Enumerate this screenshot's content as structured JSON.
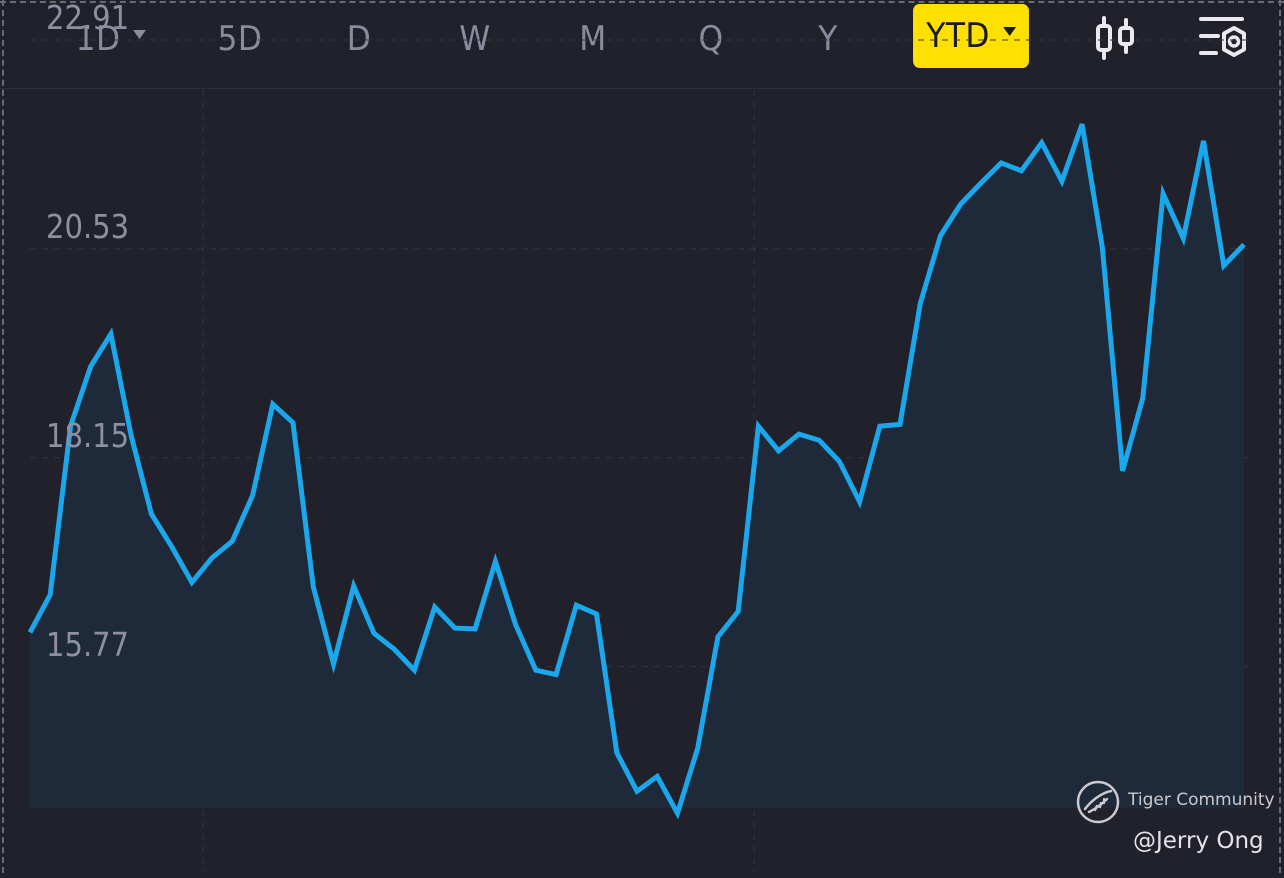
{
  "toolbar": {
    "periods": [
      {
        "label": "1D",
        "has_dropdown": true,
        "active": false
      },
      {
        "label": "5D",
        "has_dropdown": false,
        "active": false
      },
      {
        "label": "D",
        "has_dropdown": false,
        "active": false
      },
      {
        "label": "W",
        "has_dropdown": false,
        "active": false
      },
      {
        "label": "M",
        "has_dropdown": false,
        "active": false
      },
      {
        "label": "Q",
        "has_dropdown": false,
        "active": false
      },
      {
        "label": "Y",
        "has_dropdown": false,
        "active": false
      },
      {
        "label": "YTD",
        "has_dropdown": true,
        "active": true
      }
    ],
    "icons": [
      "candlestick-chart-icon",
      "chart-settings-icon"
    ],
    "active_color": "#ffe000"
  },
  "chart_data": {
    "type": "area",
    "y_ticks": [
      "22.91",
      "20.53",
      "18.15",
      "15.77"
    ],
    "ylim": [
      14.16,
      22.34
    ],
    "grid": true,
    "line_color": "#1aa7ec",
    "fill_color": "#1f2a3a",
    "series": [
      {
        "values": [
          16.16,
          16.59,
          18.51,
          19.19,
          19.56,
          18.4,
          17.51,
          17.14,
          16.73,
          17.01,
          17.2,
          17.72,
          18.76,
          18.55,
          16.68,
          15.8,
          16.69,
          16.15,
          15.97,
          15.73,
          16.45,
          16.21,
          16.2,
          16.97,
          16.25,
          15.73,
          15.68,
          16.47,
          16.37,
          14.79,
          14.35,
          14.52,
          14.1,
          14.84,
          16.11,
          16.4,
          18.51,
          18.23,
          18.42,
          18.35,
          18.11,
          17.65,
          18.51,
          18.53,
          19.91,
          20.68,
          21.04,
          21.28,
          21.51,
          21.42,
          21.74,
          21.3,
          21.95,
          20.54,
          18.0,
          18.83,
          21.16,
          20.65,
          21.76,
          20.34,
          20.58
        ]
      }
    ]
  },
  "watermark": {
    "brand": "Tiger Community",
    "handle": "@Jerry Ong"
  }
}
